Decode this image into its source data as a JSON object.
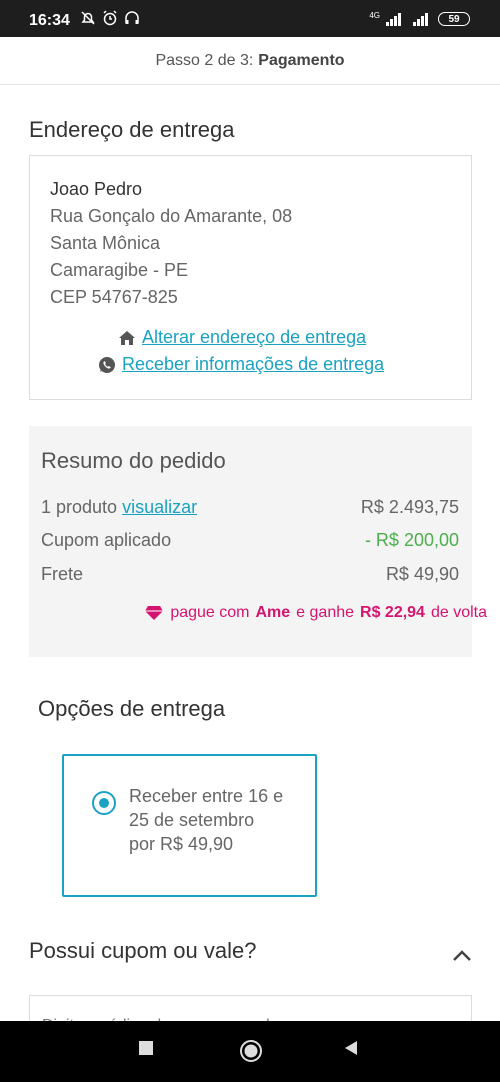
{
  "status_bar": {
    "time": "16:34",
    "network_label": "4G",
    "battery": "59"
  },
  "header": {
    "step_prefix": "Passo 2 de 3:",
    "step_name": "Pagamento"
  },
  "address_section": {
    "title": "Endereço de entrega",
    "name": "Joao Pedro",
    "street": "Rua Gonçalo do Amarante, 08",
    "district": "Santa Mônica",
    "city": "Camaragibe - PE",
    "zip": "CEP 54767-825",
    "change_link": "Alterar endereço de entrega",
    "whatsapp_link": "Receber informações de entrega"
  },
  "summary": {
    "title": "Resumo do pedido",
    "products_label": "1 produto",
    "products_link": "visualizar",
    "products_value": "R$ 2.493,75",
    "coupon_label": "Cupom aplicado",
    "coupon_value": "- R$ 200,00",
    "shipping_label": "Frete",
    "shipping_value": "R$ 49,90",
    "ame_prefix": "pague com",
    "ame_brand": "Ame",
    "ame_middle": "e ganhe",
    "ame_amount": "R$ 22,94",
    "ame_suffix": "de volta"
  },
  "delivery": {
    "title": "Opções de entrega",
    "option_line1": "Receber entre 16 e",
    "option_line2": "25 de setembro",
    "option_line3": "por R$ 49,90"
  },
  "coupon": {
    "title": "Possui cupom ou vale?",
    "placeholder": "Digite o código do cupom ou vale"
  },
  "colors": {
    "accent": "#1aa2c2",
    "discount_green": "#4cae4c",
    "ame_pink": "#d4146f"
  }
}
